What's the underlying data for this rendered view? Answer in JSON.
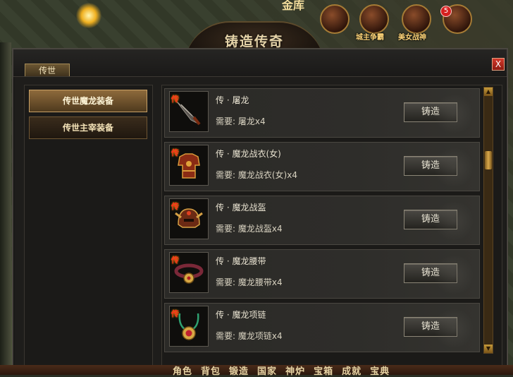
{
  "window": {
    "title": "铸造传奇",
    "active_tab": "传世",
    "close_label": "X"
  },
  "categories": [
    {
      "label": "传世魔龙装备",
      "active": true
    },
    {
      "label": "传世主宰装备",
      "active": false
    }
  ],
  "items": [
    {
      "tag": "传",
      "name": "传 · 屠龙",
      "requirement": "需要: 屠龙x4",
      "button": "铸造",
      "icon": "sword-icon"
    },
    {
      "tag": "传",
      "name": "传 · 魔龙战衣(女)",
      "requirement": "需要: 魔龙战衣(女)x4",
      "button": "铸造",
      "icon": "armor-icon"
    },
    {
      "tag": "传",
      "name": "传 · 魔龙战盔",
      "requirement": "需要: 魔龙战盔x4",
      "button": "铸造",
      "icon": "helmet-icon"
    },
    {
      "tag": "传",
      "name": "传 · 魔龙腰带",
      "requirement": "需要: 魔龙腰带x4",
      "button": "铸造",
      "icon": "belt-icon"
    },
    {
      "tag": "传",
      "name": "传 · 魔龙项链",
      "requirement": "需要: 魔龙项链x4",
      "button": "铸造",
      "icon": "necklace-icon"
    }
  ],
  "top_bar": {
    "icons": [
      {
        "label": "城主争霸",
        "icon": "castle-lord-icon"
      },
      {
        "label": "美女战神",
        "icon": "goddess-icon"
      }
    ],
    "badge_count": "5",
    "partial_text": "金库"
  },
  "bottom_menu": [
    "角色",
    "背包",
    "锻造",
    "国家",
    "神炉",
    "宝箱",
    "成就",
    "宝典"
  ],
  "colors": {
    "accent_gold": "#c8a166",
    "tag_red": "#ff2a1e",
    "close_red": "#d43a2c"
  }
}
